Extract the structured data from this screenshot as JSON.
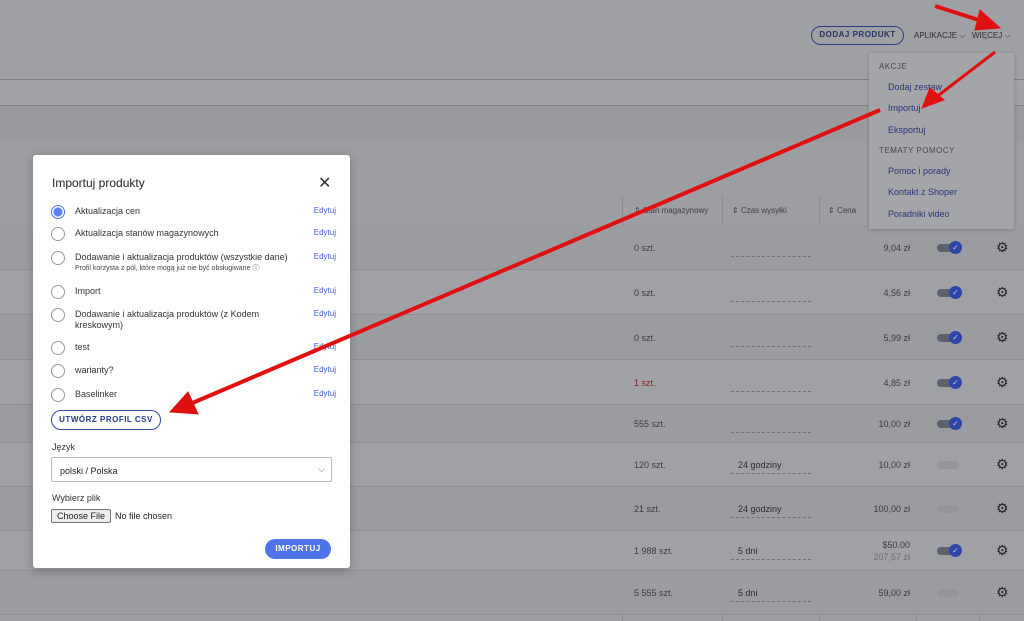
{
  "header": {
    "add_product": "DODAJ PRODUKT",
    "apps": "APLIKACJE",
    "more": "WIĘCEJ"
  },
  "menu": {
    "section1": "AKCJE",
    "items1": [
      "Dodaj zestaw",
      "Importuj",
      "Eksportuj"
    ],
    "section2": "TEMATY POMOCY",
    "items2": [
      "Pomoc i porady",
      "Kontakt z Shoper",
      "Poradniki video"
    ]
  },
  "table": {
    "headers": [
      "Stan magazynowy",
      "Czas wysyłki",
      "Cena"
    ],
    "rows": [
      {
        "stock": "0 szt.",
        "ship": "",
        "price": "9,04 zł",
        "active": true
      },
      {
        "stock": "0 szt.",
        "ship": "",
        "price": "4,56 zł",
        "active": true
      },
      {
        "stock": "0 szt.",
        "ship": "",
        "price": "5,99 zł",
        "active": true
      },
      {
        "stock": "1 szt.",
        "ship": "",
        "price": "4,85 zł",
        "active": true,
        "low": true
      },
      {
        "stock": "555 szt.",
        "ship": "",
        "price": "10,00 zł",
        "active": true
      },
      {
        "stock": "120 szt.",
        "ship": "24 godziny",
        "price": "10,00 zł",
        "active": false
      },
      {
        "stock": "21 szt.",
        "ship": "24 godziny",
        "price": "100,00 zł",
        "active": false
      },
      {
        "stock": "1 988 szt.",
        "ship": "5 dni",
        "price": "$50.00",
        "price2": "207,57 zł",
        "active": true
      },
      {
        "stock": "5 555 szt.",
        "ship": "5 dni",
        "price": "59,00 zł",
        "active": false
      }
    ]
  },
  "modal": {
    "title": "Importuj produkty",
    "edit": "Edytuj",
    "options": [
      {
        "label": "Aktualizacja cen",
        "selected": true
      },
      {
        "label": "Aktualizacja stanów magazynowych"
      },
      {
        "label": "Dodawanie i aktualizacja produktów (wszystkie dane)",
        "sub": "Profil korzysta z pól, które mogą już nie być obsługiwane"
      },
      {
        "label": "Import"
      },
      {
        "label": "Dodawanie i aktualizacja produktów (z Kodem kreskowym)"
      },
      {
        "label": "test"
      },
      {
        "label": "warianty?"
      },
      {
        "label": "Baselinker"
      }
    ],
    "csv_button": "UTWÓRZ PROFIL CSV",
    "lang_label": "Język",
    "lang_value": "polski / Polska",
    "file_label": "Wybierz plik",
    "file_button": "Choose File",
    "file_status": "No file chosen",
    "import_button": "IMPORTUJ"
  },
  "colors": {
    "accent": "#4f74e8",
    "arrow": "#e01010"
  }
}
